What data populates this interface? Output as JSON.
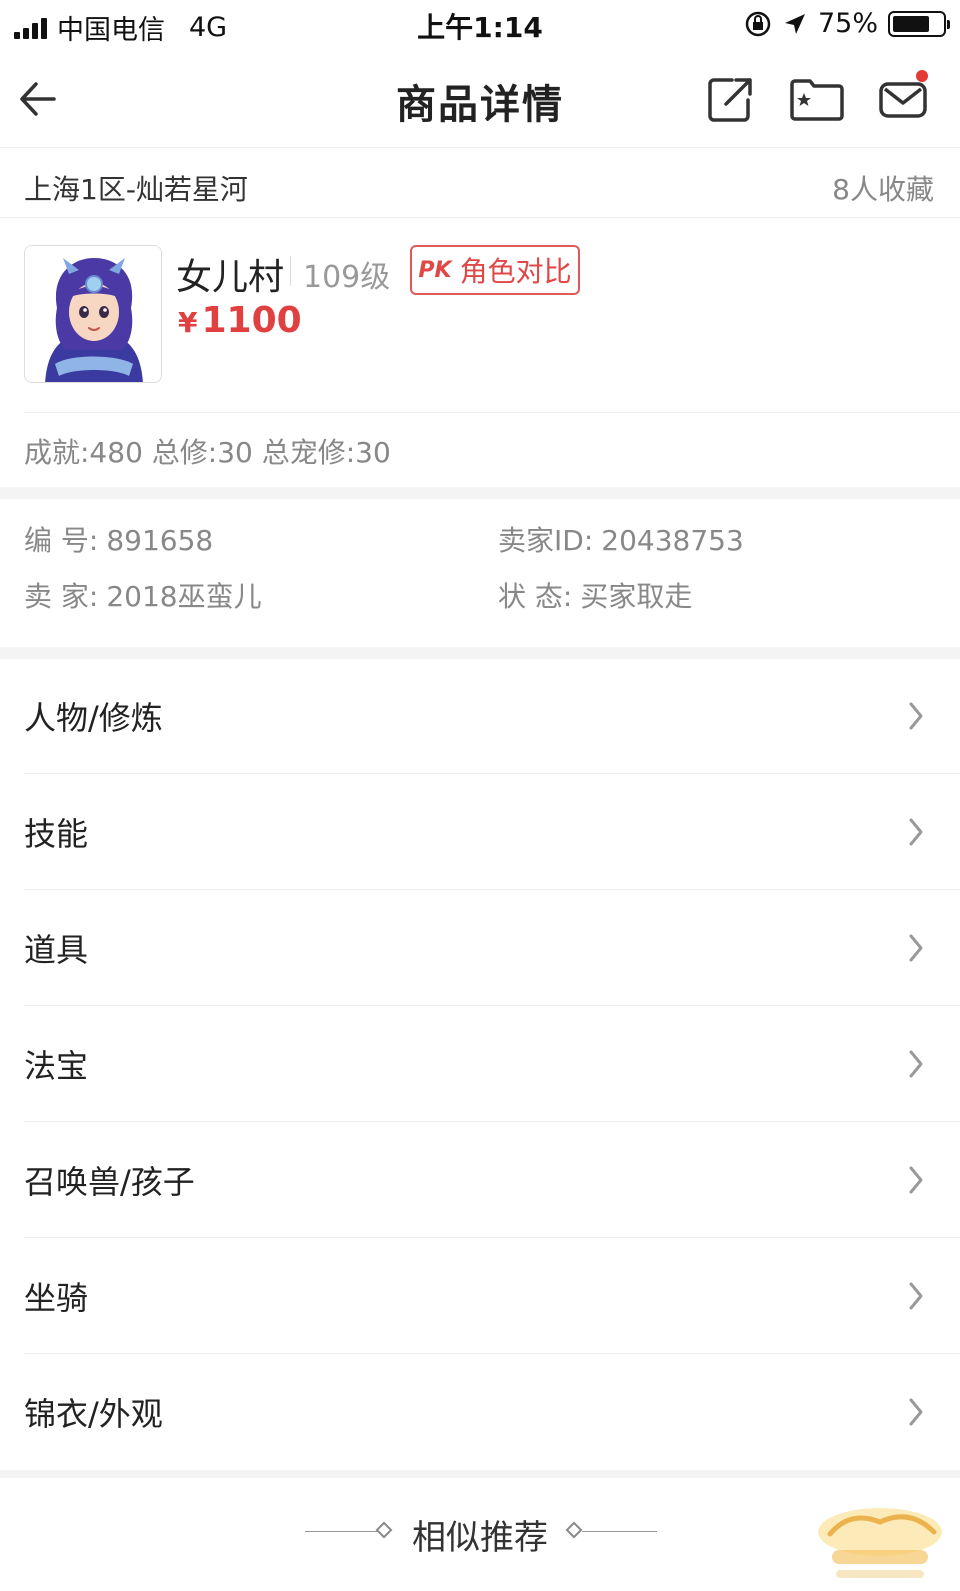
{
  "status_bar": {
    "carrier": "中国电信",
    "network": "4G",
    "time": "上午1:14",
    "battery": "75%",
    "battery_level": 0.75
  },
  "nav": {
    "title": "商品详情"
  },
  "header": {
    "server": "上海1区-灿若星河",
    "favorites": "8人收藏"
  },
  "product": {
    "school": "女儿村",
    "level": "109级",
    "compare_label": "角色对比",
    "pk_badge": "PK",
    "currency": "¥",
    "price": "1100",
    "stats": "成就:480 总修:30 总宠修:30"
  },
  "info": {
    "id_label": "编 号:",
    "id_value": "891658",
    "seller_id_label": "卖家ID:",
    "seller_id_value": "20438753",
    "seller_label": "卖 家:",
    "seller_value": "2018巫蛮儿",
    "status_label": "状 态:",
    "status_value": "买家取走"
  },
  "menu": [
    {
      "label": "人物/修炼"
    },
    {
      "label": "技能"
    },
    {
      "label": "道具"
    },
    {
      "label": "法宝"
    },
    {
      "label": "召唤兽/孩子"
    },
    {
      "label": "坐骑"
    },
    {
      "label": "锦衣/外观"
    }
  ],
  "similar": {
    "title": "相似推荐"
  },
  "icons": {
    "back": "arrow-left-icon",
    "share": "share-icon",
    "favorite": "folder-star-icon",
    "message": "mail-icon",
    "chevron": "chevron-right-icon"
  },
  "colors": {
    "accent": "#e04848",
    "muted": "#888888",
    "divider": "#ececec"
  }
}
